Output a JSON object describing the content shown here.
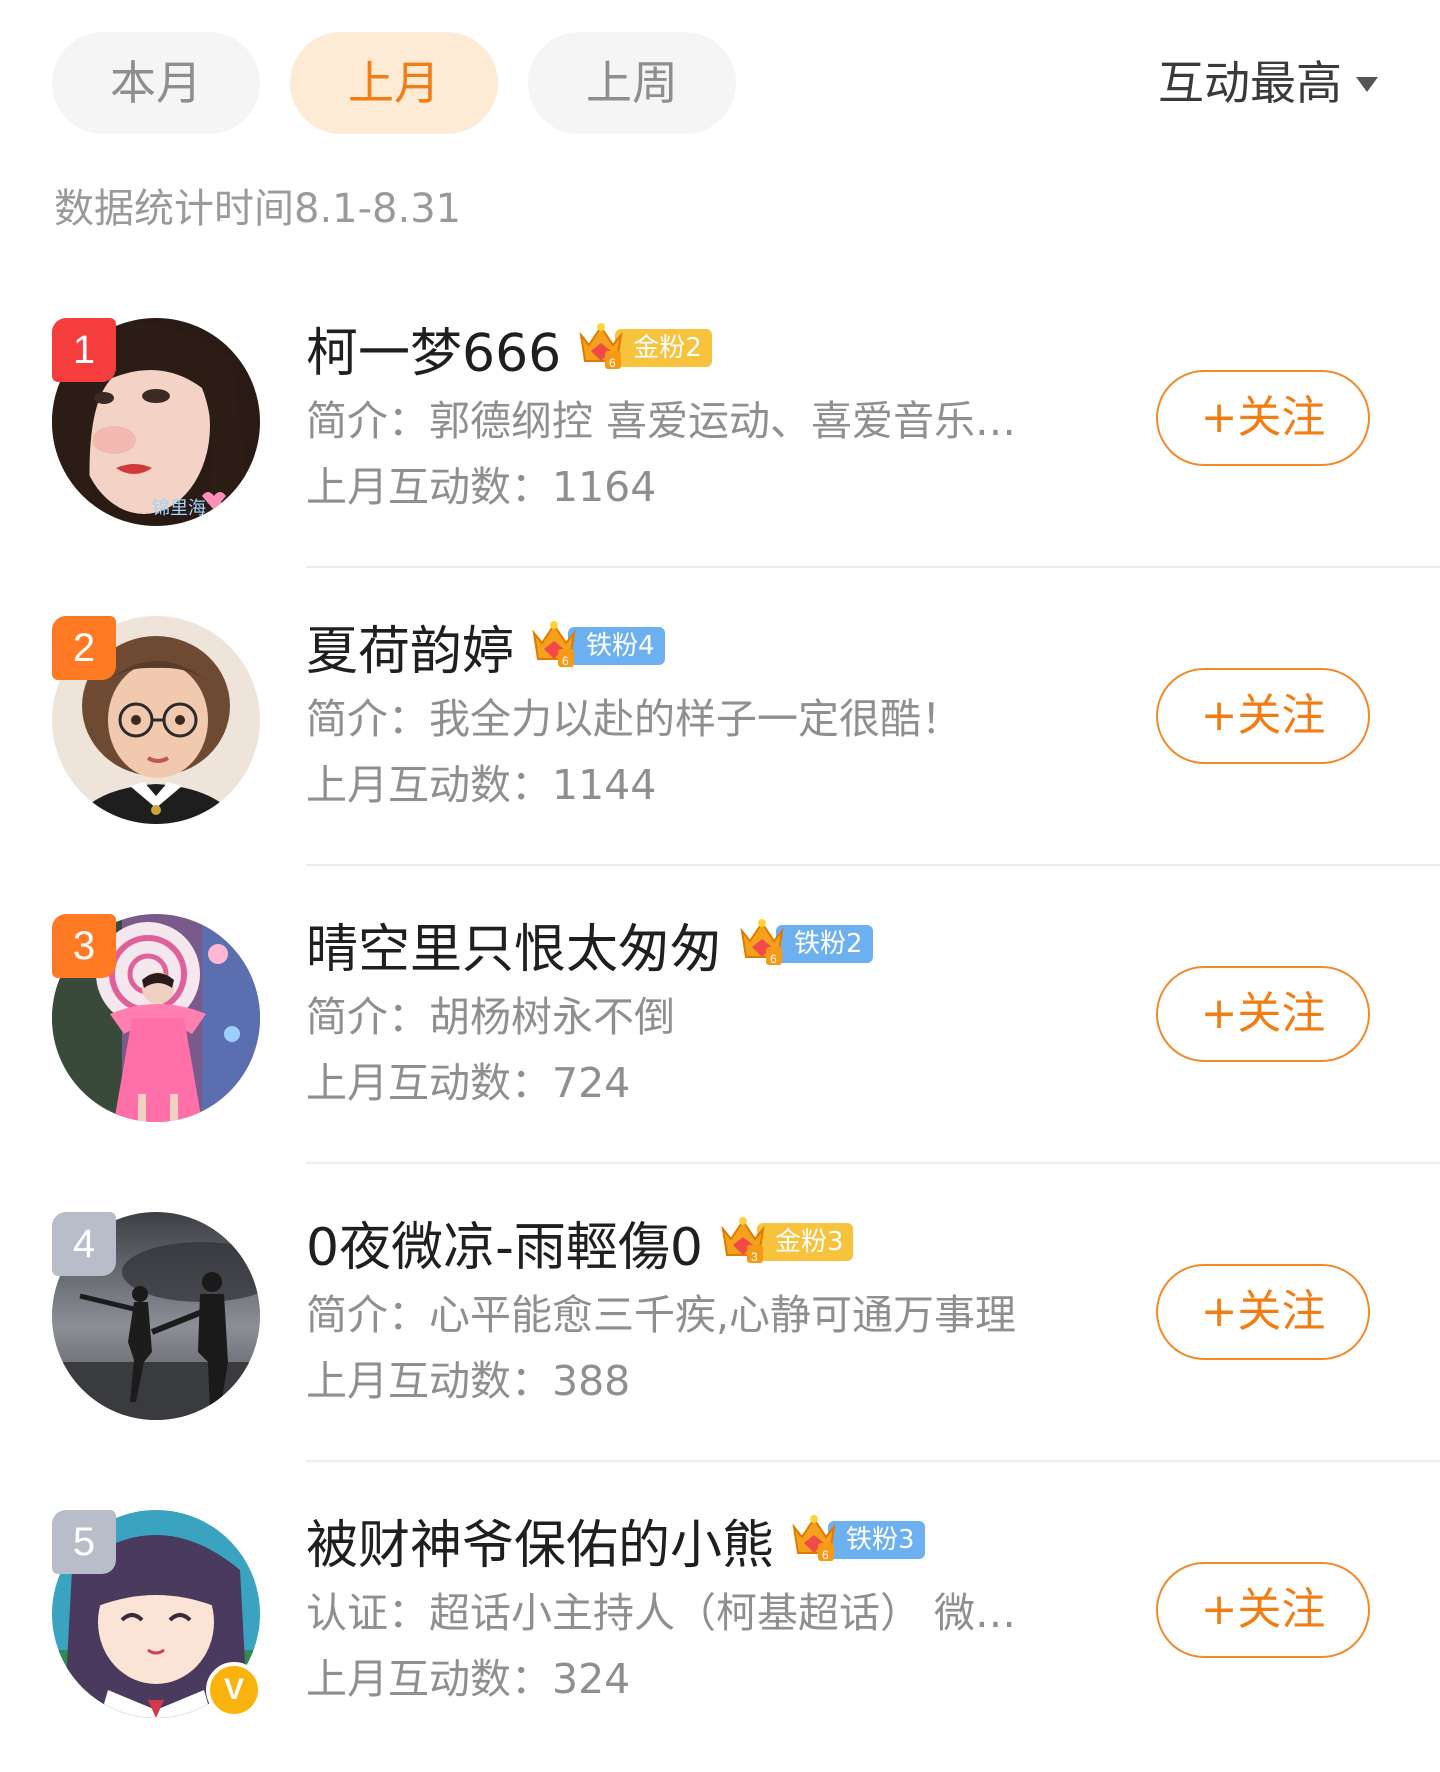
{
  "tabs": {
    "this_month": "本月",
    "last_month": "上月",
    "last_week": "上周",
    "active": "上月"
  },
  "sort": {
    "label": "互动最高"
  },
  "stat_range": "数据统计时间8.1-8.31",
  "colors": {
    "accent": "#f27d13",
    "active_tab_bg": "#fdebd6",
    "rank_1": "#f53d3d",
    "rank_2_3": "#ff7a22",
    "rank_4_5": "#b9bdc9",
    "gold_fan": "#f7c23c",
    "iron_fan": "#6cb0f0"
  },
  "users": [
    {
      "rank": "1",
      "name": "柯一梦666",
      "fan_badge": "金粉2",
      "fan_type": "gold",
      "crown_level": "6",
      "bio": "简介：郭德纲控 喜爱运动、喜爱音乐…",
      "count": "上月互动数：1164",
      "follow_label": "+关注",
      "avatar_watermark": "锦里海之",
      "avatar_icon": "woman-portrait-avatar"
    },
    {
      "rank": "2",
      "name": "夏荷韵婷",
      "fan_badge": "铁粉4",
      "fan_type": "iron",
      "crown_level": "6",
      "bio": "简介：我全力以赴的样子一定很酷！",
      "count": "上月互动数：1144",
      "follow_label": "+关注",
      "avatar_icon": "cartoon-woman-glasses-avatar"
    },
    {
      "rank": "3",
      "name": "晴空里只恨太匆匆",
      "fan_badge": "铁粉2",
      "fan_type": "iron",
      "crown_level": "6",
      "bio": "简介：胡杨树永不倒",
      "count": "上月互动数：724",
      "follow_label": "+关注",
      "avatar_icon": "pink-dress-dancer-avatar"
    },
    {
      "rank": "4",
      "name": "0夜微凉-雨輕傷0",
      "fan_badge": "金粉3",
      "fan_type": "gold",
      "crown_level": "3",
      "bio": "简介：心平能愈三千疾,心静可通万事理",
      "count": "上月互动数：388",
      "follow_label": "+关注",
      "avatar_icon": "couple-silhouette-avatar"
    },
    {
      "rank": "5",
      "name": "被财神爷保佑的小熊",
      "fan_badge": "铁粉3",
      "fan_type": "iron",
      "crown_level": "6",
      "bio": "认证：超话小主持人（柯基超话） 微…",
      "count": "上月互动数：324",
      "follow_label": "+关注",
      "verified_badge": "V",
      "avatar_icon": "anime-girl-avatar"
    }
  ]
}
